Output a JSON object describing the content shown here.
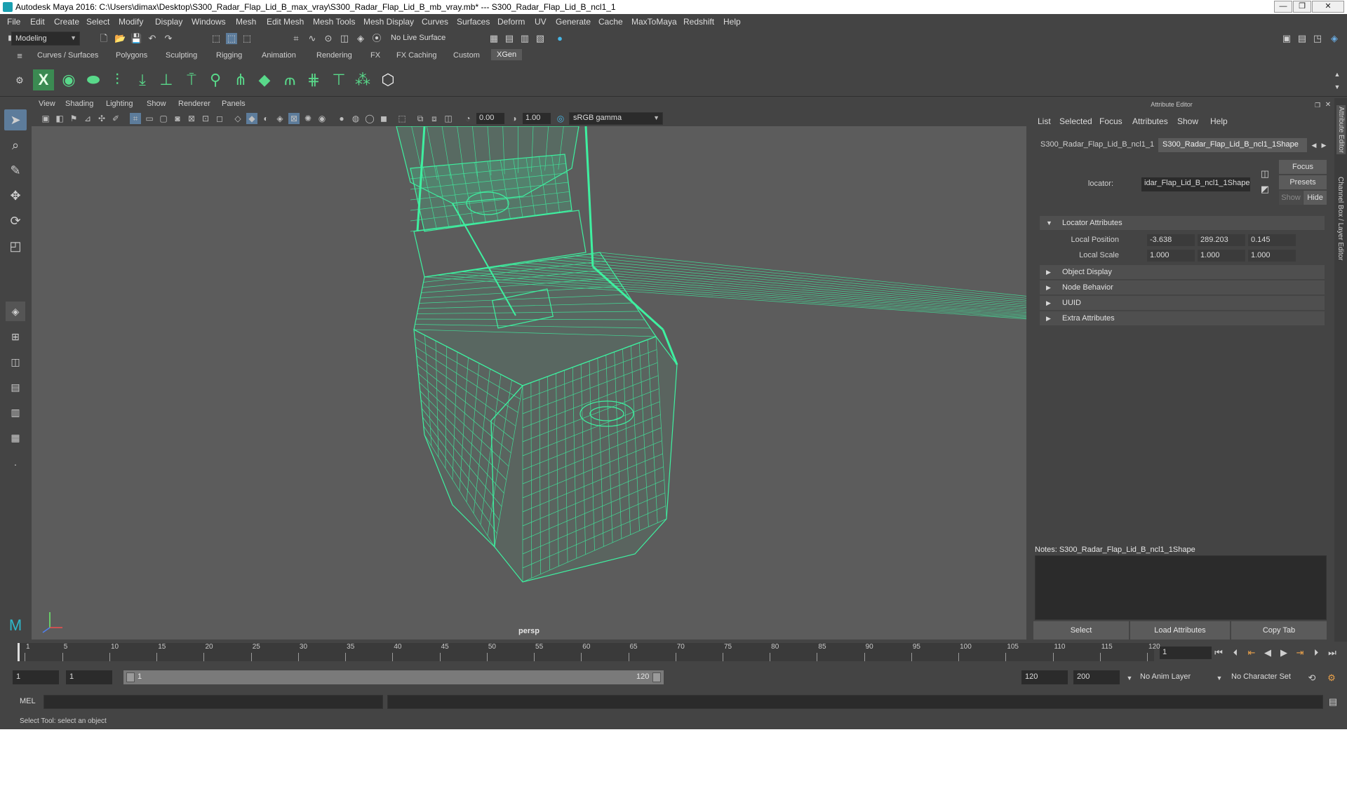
{
  "window": {
    "title": "Autodesk Maya 2016: C:\\Users\\dimax\\Desktop\\S300_Radar_Flap_Lid_B_max_vray\\S300_Radar_Flap_Lid_B_mb_vray.mb*   ---   S300_Radar_Flap_Lid_B_ncl1_1",
    "minimize": "—",
    "maximize": "❐",
    "close": "✕"
  },
  "menubar": [
    "File",
    "Edit",
    "Create",
    "Select",
    "Modify",
    "Display",
    "Windows",
    "Mesh",
    "Edit Mesh",
    "Mesh Tools",
    "Mesh Display",
    "Curves",
    "Surfaces",
    "Deform",
    "UV",
    "Generate",
    "Cache",
    "MaxToMaya",
    "Redshift",
    "Help"
  ],
  "statusline": {
    "mode": "Modeling",
    "live_surface": "No Live Surface"
  },
  "shelf_tabs": [
    "Curves / Surfaces",
    "Polygons",
    "Sculpting",
    "Rigging",
    "Animation",
    "Rendering",
    "FX",
    "FX Caching",
    "Custom",
    "XGen"
  ],
  "viewport": {
    "menu": [
      "View",
      "Shading",
      "Lighting",
      "Show",
      "Renderer",
      "Panels"
    ],
    "exposure": "0.00",
    "gamma": "1.00",
    "color_space": "sRGB gamma",
    "camera": "persp"
  },
  "attribute_editor": {
    "title": "Attribute Editor",
    "menu": [
      "List",
      "Selected",
      "Focus",
      "Attributes",
      "Show",
      "Help"
    ],
    "tabs": [
      "S300_Radar_Flap_Lid_B_ncl1_1",
      "S300_Radar_Flap_Lid_B_ncl1_1Shape"
    ],
    "locator_label": "locator:",
    "locator_value": "idar_Flap_Lid_B_ncl1_1Shape",
    "focus_btn": "Focus",
    "presets_btn": "Presets",
    "show_btn": "Show",
    "hide_btn": "Hide",
    "sections": {
      "locator_attributes": "Locator Attributes",
      "object_display": "Object Display",
      "node_behavior": "Node Behavior",
      "uuid": "UUID",
      "extra_attributes": "Extra Attributes"
    },
    "local_position": {
      "label": "Local Position",
      "x": "-3.638",
      "y": "289.203",
      "z": "0.145"
    },
    "local_scale": {
      "label": "Local Scale",
      "x": "1.000",
      "y": "1.000",
      "z": "1.000"
    },
    "notes": "Notes:  S300_Radar_Flap_Lid_B_ncl1_1Shape",
    "buttons": {
      "select": "Select",
      "load": "Load Attributes",
      "copy": "Copy Tab"
    }
  },
  "side_tabs": [
    "Attribute Editor",
    "Channel Box / Layer Editor"
  ],
  "timeline": {
    "ticks": [
      "1",
      "5",
      "10",
      "15",
      "20",
      "25",
      "30",
      "35",
      "40",
      "45",
      "50",
      "55",
      "60",
      "65",
      "70",
      "75",
      "80",
      "85",
      "90",
      "95",
      "100",
      "105",
      "110",
      "115",
      "120"
    ],
    "current_frame": "1"
  },
  "range": {
    "start": "1",
    "playback_start": "1",
    "slider_start": "1",
    "slider_end": "120",
    "playback_end": "120",
    "end": "200",
    "anim_layer": "No Anim Layer",
    "character_set": "No Character Set"
  },
  "command_line": {
    "label": "MEL"
  },
  "help_line": "Select Tool: select an object",
  "colors": {
    "wireframe": "#3ef0a0",
    "viewport_bg": "#5c5c5c",
    "ui_bg": "#444444",
    "accent": "#5d7c9b"
  }
}
